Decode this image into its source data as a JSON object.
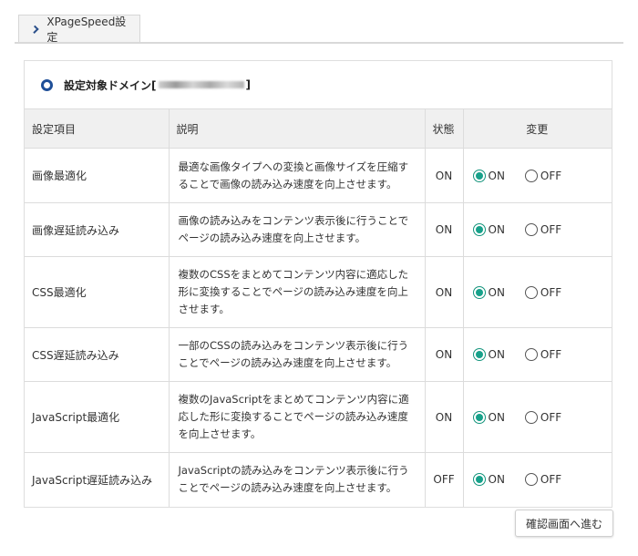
{
  "tab": {
    "label": "XPageSpeed設定"
  },
  "domain": {
    "label_prefix": "設定対象ドメイン[",
    "label_suffix": "]"
  },
  "table": {
    "headers": {
      "item": "設定項目",
      "description": "説明",
      "state": "状態",
      "change": "変更"
    },
    "radio_labels": {
      "on": "ON",
      "off": "OFF"
    },
    "rows": [
      {
        "item": "画像最適化",
        "description": "最適な画像タイプへの変換と画像サイズを圧縮することで画像の読み込み速度を向上させます。",
        "state": "ON",
        "selected": "on"
      },
      {
        "item": "画像遅延読み込み",
        "description": "画像の読み込みをコンテンツ表示後に行うことでページの読み込み速度を向上させます。",
        "state": "ON",
        "selected": "on"
      },
      {
        "item": "CSS最適化",
        "description": "複数のCSSをまとめてコンテンツ内容に適応した形に変換することでページの読み込み速度を向上させます。",
        "state": "ON",
        "selected": "on"
      },
      {
        "item": "CSS遅延読み込み",
        "description": "一部のCSSの読み込みをコンテンツ表示後に行うことでページの読み込み速度を向上させます。",
        "state": "ON",
        "selected": "on"
      },
      {
        "item": "JavaScript最適化",
        "description": "複数のJavaScriptをまとめてコンテンツ内容に適応した形に変換することでページの読み込み速度を向上させます。",
        "state": "ON",
        "selected": "on"
      },
      {
        "item": "JavaScript遅延読み込み",
        "description": "JavaScriptの読み込みをコンテンツ表示後に行うことでページの読み込み速度を向上させます。",
        "state": "OFF",
        "selected": "on"
      }
    ]
  },
  "footer": {
    "confirm_label": "確認画面へ進む"
  },
  "colors": {
    "accent": "#1f4f98",
    "radio_selected": "#17a18a",
    "header_bg": "#f0f0f0"
  }
}
